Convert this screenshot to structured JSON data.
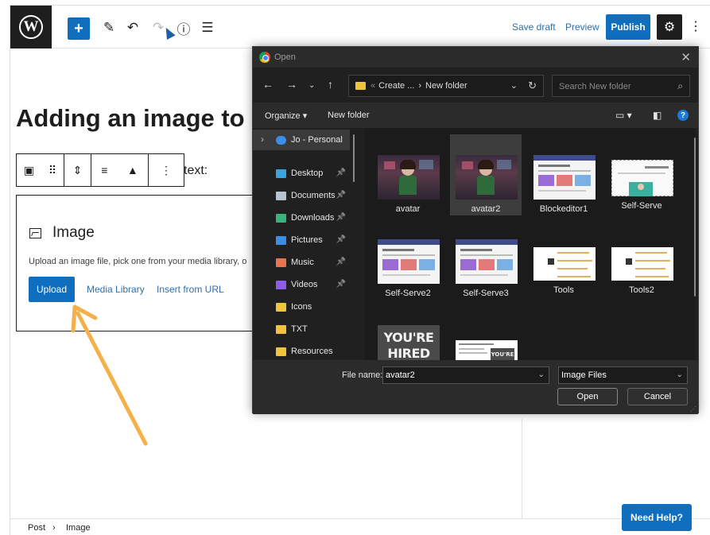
{
  "editor": {
    "topbar": {
      "add_label": "+",
      "save_draft": "Save draft",
      "preview": "Preview",
      "publish": "Publish"
    },
    "post_title": "Adding an image to",
    "paragraph_fragment": "text:",
    "image_block": {
      "title": "Image",
      "description": "Upload an image file, pick one from your media library, o",
      "upload": "Upload",
      "media_library": "Media Library",
      "insert_from_url": "Insert from URL"
    },
    "breadcrumb": {
      "post": "Post",
      "separator": "›",
      "image": "Image"
    },
    "need_help": "Need Help?"
  },
  "dialog": {
    "title": "Open",
    "address": {
      "prefix": "«",
      "segment1": "Create ...",
      "separator": "›",
      "segment2": "New folder"
    },
    "search_placeholder": "Search New folder",
    "commands": {
      "organize": "Organize",
      "new_folder": "New folder"
    },
    "nav_pane": [
      {
        "label": "Jo - Personal",
        "icon": "onedrive-icon",
        "color": "#3b8ee8",
        "pinned": false,
        "selected": true
      },
      {
        "label": "Desktop",
        "icon": "desktop-icon",
        "color": "#3ba3e0",
        "pinned": true
      },
      {
        "label": "Documents",
        "icon": "documents-icon",
        "color": "#b9c3cf",
        "pinned": true
      },
      {
        "label": "Downloads",
        "icon": "downloads-icon",
        "color": "#36b37e",
        "pinned": true
      },
      {
        "label": "Pictures",
        "icon": "pictures-icon",
        "color": "#3b8ee8",
        "pinned": true
      },
      {
        "label": "Music",
        "icon": "music-icon",
        "color": "#e8744f",
        "pinned": true
      },
      {
        "label": "Videos",
        "icon": "videos-icon",
        "color": "#8e5ce6",
        "pinned": true
      },
      {
        "label": "Icons",
        "icon": "folder-icon",
        "color": "#f0c33c",
        "pinned": false
      },
      {
        "label": "TXT",
        "icon": "folder-icon",
        "color": "#f0c33c",
        "pinned": false
      },
      {
        "label": "Resources",
        "icon": "folder-icon",
        "color": "#f0c33c",
        "pinned": false
      }
    ],
    "files": [
      {
        "name": "avatar",
        "kind": "avatar"
      },
      {
        "name": "avatar2",
        "kind": "avatar",
        "selected": true
      },
      {
        "name": "Blockeditor1",
        "kind": "page"
      },
      {
        "name": "Self-Serve",
        "kind": "selfserve"
      },
      {
        "name": "Self-Serve2",
        "kind": "page"
      },
      {
        "name": "Self-Serve3",
        "kind": "page"
      },
      {
        "name": "Tools",
        "kind": "diagram"
      },
      {
        "name": "Tools2",
        "kind": "diagram"
      },
      {
        "name": "",
        "kind": "hired",
        "text": "YOU'RE HIRED"
      },
      {
        "name": "",
        "kind": "hiredpage",
        "text": "YOU'RE HIRED"
      }
    ],
    "file_name_label": "File name:",
    "file_name_value": "avatar2",
    "file_type": "Image Files",
    "open_button": "Open",
    "cancel_button": "Cancel"
  },
  "colors": {
    "wp_blue": "#0f6ebd",
    "annotation_arrow": "#f5b04a",
    "dialog_bg": "#202020"
  }
}
